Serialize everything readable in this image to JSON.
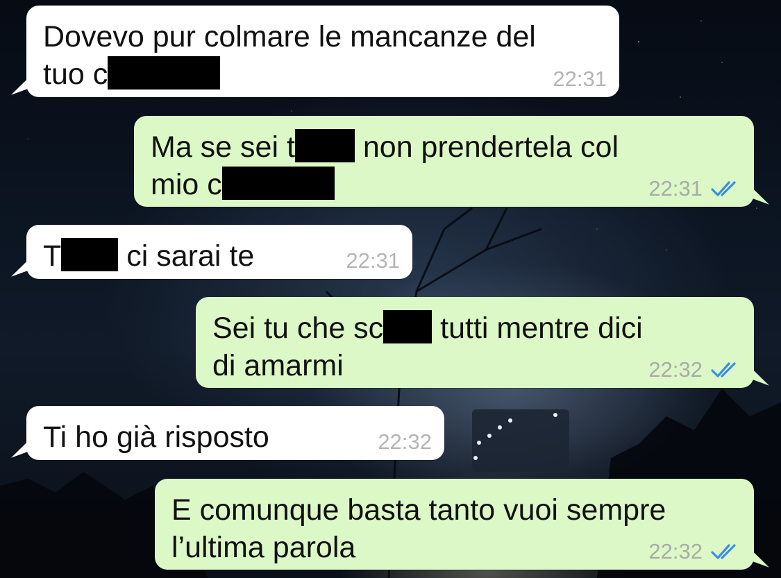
{
  "colors": {
    "incoming_bubble": "#ffffff",
    "outgoing_bubble": "#dcf8c6",
    "read_ticks": "#3a8ee6",
    "timestamp": "#a8aca6"
  },
  "messages": [
    {
      "direction": "incoming",
      "line1_a": "Dovevo pur colmare le mancanze del",
      "line2_a": "tuo c",
      "redacted": true,
      "time": "22:31"
    },
    {
      "direction": "outgoing",
      "line1_a": "Ma se sei t",
      "line1_b": "non prendertela col",
      "line2_a": "mio c",
      "redacted": true,
      "time": "22:31",
      "status_icon": "double-check-icon"
    },
    {
      "direction": "incoming",
      "line1_a": "T",
      "line1_b": "ci sarai te",
      "redacted": true,
      "time": "22:31"
    },
    {
      "direction": "outgoing",
      "line1_a": "Sei tu che sc",
      "line1_b": "tutti mentre dici",
      "line2_a": "di amarmi",
      "redacted": true,
      "time": "22:32",
      "status_icon": "double-check-icon"
    },
    {
      "direction": "incoming",
      "line1_a": "Ti ho già risposto",
      "time": "22:32"
    },
    {
      "direction": "outgoing",
      "line1_a": "E comunque basta tanto vuoi sempre",
      "line2_a": "l’ultima parola",
      "time": "22:32",
      "status_icon": "double-check-icon"
    }
  ]
}
